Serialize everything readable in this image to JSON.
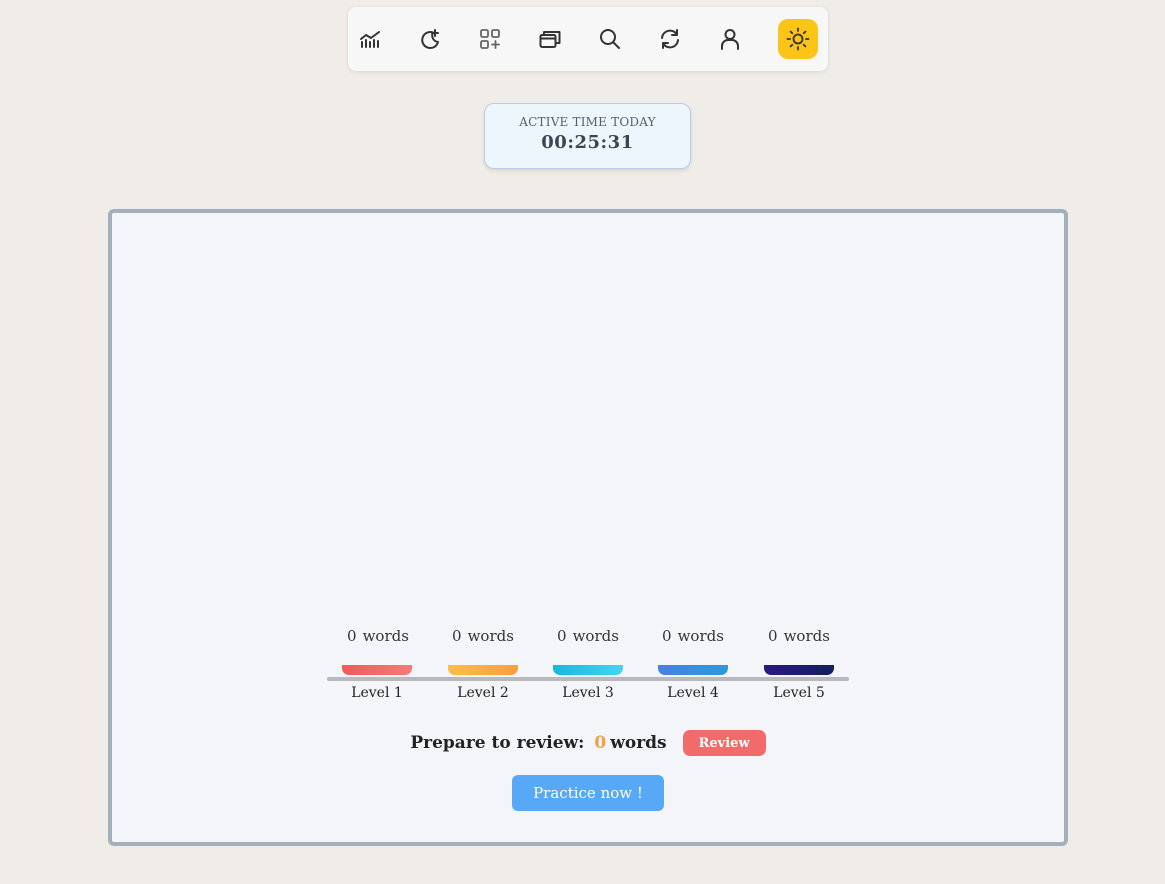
{
  "toolbar": {
    "buttons": [
      {
        "icon": "statistics-chart-icon",
        "active": false
      },
      {
        "icon": "moon-plus-icon",
        "active": false
      },
      {
        "icon": "grid-add-icon",
        "active": false
      },
      {
        "icon": "cards-icon",
        "active": false
      },
      {
        "icon": "search-icon",
        "active": false
      },
      {
        "icon": "refresh-icon",
        "active": false
      },
      {
        "icon": "user-icon",
        "active": false
      },
      {
        "icon": "sun-icon",
        "active": true
      }
    ],
    "active_color": "#fbc417"
  },
  "timer": {
    "label": "ACTIVE TIME TODAY",
    "value": "00:25:31"
  },
  "levels": [
    {
      "count": "0",
      "unit": "words",
      "label": "Level 1",
      "color_from": "#ee5a5a",
      "color_to": "#f77a7a"
    },
    {
      "count": "0",
      "unit": "words",
      "label": "Level 2",
      "color_from": "#f8c043",
      "color_to": "#f89e3e"
    },
    {
      "count": "0",
      "unit": "words",
      "label": "Level 3",
      "color_from": "#16b9d8",
      "color_to": "#42d6f0"
    },
    {
      "count": "0",
      "unit": "words",
      "label": "Level 4",
      "color_from": "#4a7fde",
      "color_to": "#2f9ad8"
    },
    {
      "count": "0",
      "unit": "words",
      "label": "Level 5",
      "color_from": "#2a1a80",
      "color_to": "#13205c"
    }
  ],
  "review": {
    "prefix": "Prepare to review:",
    "count": "0",
    "suffix": "words",
    "button_label": "Review"
  },
  "practice": {
    "button_label": "Practice now !"
  }
}
